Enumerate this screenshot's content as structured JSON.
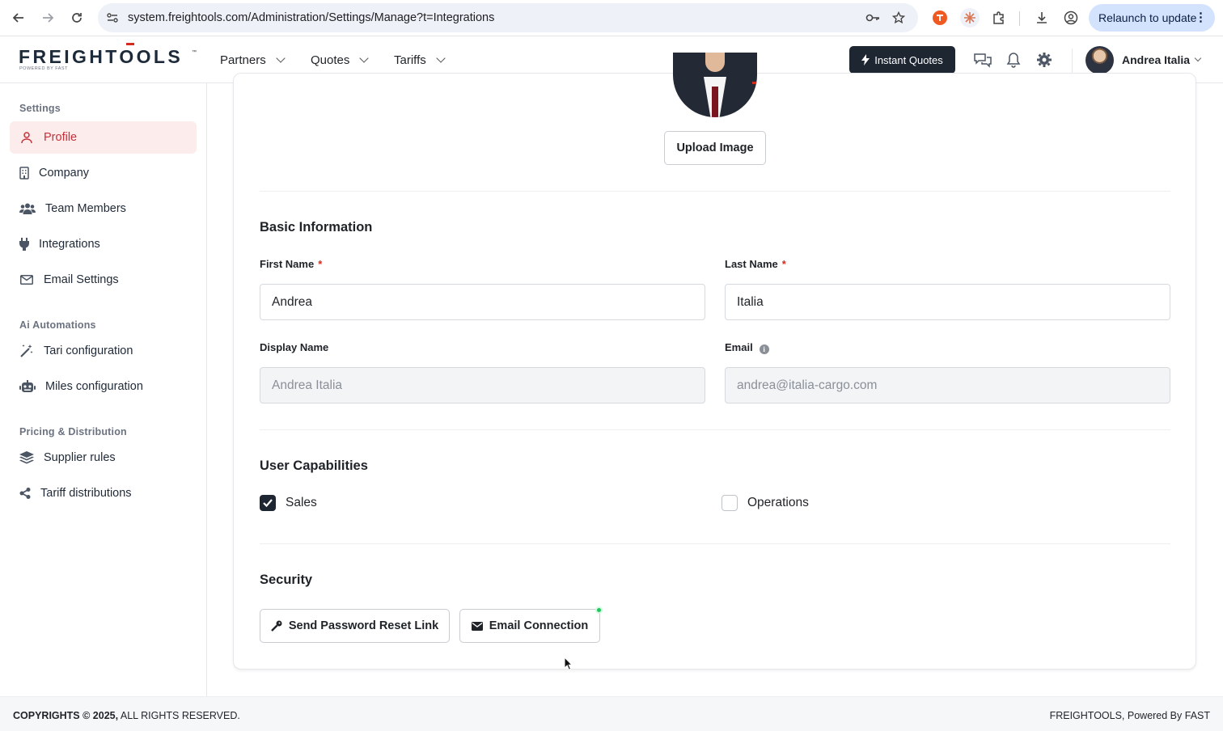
{
  "browser": {
    "url": "system.freightools.com/Administration/Settings/Manage?t=Integrations",
    "relaunch_label": "Relaunch to update"
  },
  "header": {
    "logo_text": "FREIGHTOOLS",
    "logo_tm": "™",
    "logo_sub": "POWERED BY FAST",
    "menu": [
      {
        "label": "Partners"
      },
      {
        "label": "Quotes"
      },
      {
        "label": "Tariffs"
      }
    ],
    "instant_quotes_label": "Instant Quotes",
    "user_name": "Andrea Italia"
  },
  "sidebar": {
    "sections": [
      {
        "title": "Settings"
      },
      {
        "title": "Ai Automations"
      },
      {
        "title": "Pricing & Distribution"
      }
    ],
    "items": [
      {
        "label": "Profile",
        "icon": "user-icon",
        "active": true
      },
      {
        "label": "Company",
        "icon": "building-icon"
      },
      {
        "label": "Team Members",
        "icon": "users-icon"
      },
      {
        "label": "Integrations",
        "icon": "plug-icon"
      },
      {
        "label": "Email Settings",
        "icon": "envelope-icon"
      },
      {
        "label": "Tari configuration",
        "icon": "magic-wand-icon"
      },
      {
        "label": "Miles configuration",
        "icon": "robot-icon"
      },
      {
        "label": "Supplier rules",
        "icon": "layers-icon"
      },
      {
        "label": "Tariff distributions",
        "icon": "share-icon"
      }
    ]
  },
  "profile": {
    "upload_label": "Upload Image",
    "basic_info_title": "Basic Information",
    "first_name_label": "First Name",
    "first_name_value": "Andrea",
    "last_name_label": "Last Name",
    "last_name_value": "Italia",
    "required_mark": "*",
    "display_name_label": "Display Name",
    "display_name_value": "Andrea Italia",
    "email_label": "Email",
    "email_value": "andrea@italia-cargo.com",
    "capabilities_title": "User Capabilities",
    "capabilities": [
      {
        "label": "Sales",
        "checked": true
      },
      {
        "label": "Operations",
        "checked": false
      }
    ],
    "security_title": "Security",
    "reset_link_label": "Send Password Reset Link",
    "email_connection_label": "Email Connection"
  },
  "footer": {
    "copyright_bold": "COPYRIGHTS © 2025,",
    "copyright_rest": " ALL RIGHTS RESERVED.",
    "right_text": "FREIGHTOOLS, Powered By FAST"
  },
  "colors": {
    "accent_red": "#c5303a",
    "dark_button": "#1e2632",
    "status_green": "#22c55e"
  }
}
